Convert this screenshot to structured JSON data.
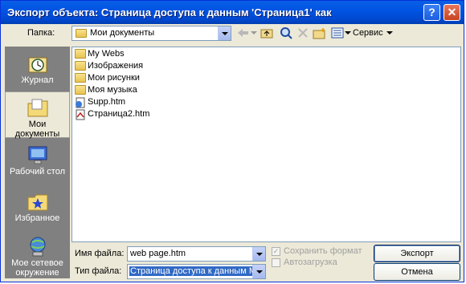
{
  "window": {
    "title": "Экспорт объекта: Страница доступа к данным 'Страница1' как",
    "help_glyph": "?",
    "close_glyph": "✕"
  },
  "toolbar": {
    "folder_label": "Папка:",
    "folder_value": "Мои документы",
    "tools_label": "Сервис",
    "icons": [
      "back-icon",
      "up-folder-icon",
      "search-web-icon",
      "delete-icon",
      "new-folder-icon",
      "views-icon"
    ]
  },
  "places": [
    {
      "label": "Журнал",
      "icon": "history-icon"
    },
    {
      "label": "Мои документы",
      "icon": "my-documents-icon"
    },
    {
      "label": "Рабочий стол",
      "icon": "desktop-icon"
    },
    {
      "label": "Избранное",
      "icon": "favorites-icon"
    },
    {
      "label": "Мое сетевое окружение",
      "icon": "network-icon"
    }
  ],
  "files": [
    {
      "name": "My Webs",
      "type": "folder"
    },
    {
      "name": "Изображения",
      "type": "folder"
    },
    {
      "name": "Мои рисунки",
      "type": "folder"
    },
    {
      "name": "Моя музыка",
      "type": "folder"
    },
    {
      "name": "Supp.htm",
      "type": "htm"
    },
    {
      "name": "Страница2.htm",
      "type": "htm"
    }
  ],
  "form": {
    "filename_label": "Имя файла:",
    "filename_value": "web page.htm",
    "filetype_label": "Тип файла:",
    "filetype_value": "Страница доступа к данным Micro",
    "save_format_label": "Сохранить формат",
    "autostart_label": "Автозагрузка",
    "save_format_mark": "✓"
  },
  "buttons": {
    "export": "Экспорт",
    "cancel": "Отмена"
  },
  "colors": {
    "title_bar": "#0054e3",
    "places_bg": "#808080",
    "dialog_bg": "#ece9d8",
    "selection": "#316ac5"
  }
}
